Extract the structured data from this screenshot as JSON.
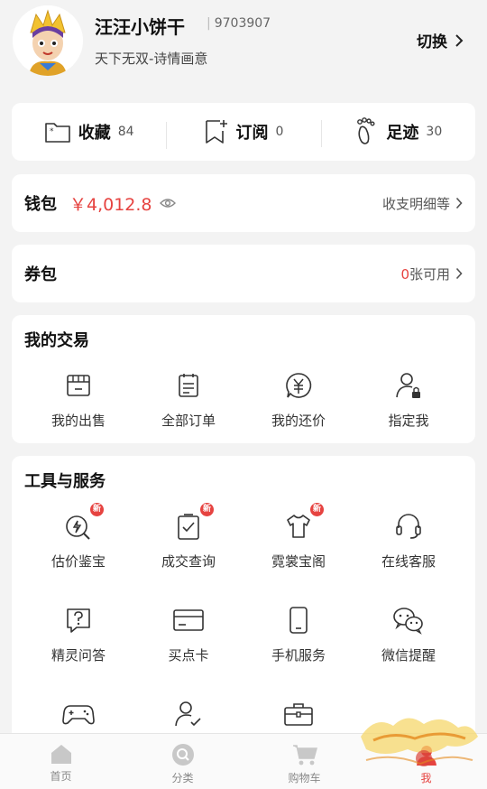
{
  "profile": {
    "username": "汪汪小饼干",
    "uid": "9703907",
    "server": "天下无双-诗情画意",
    "switch_label": "切换"
  },
  "stats": [
    {
      "label": "收藏",
      "count": "84",
      "icon": "folder-icon"
    },
    {
      "label": "订阅",
      "count": "0",
      "icon": "bookmark-add-icon"
    },
    {
      "label": "足迹",
      "count": "30",
      "icon": "footprint-icon"
    }
  ],
  "wallet": {
    "title": "钱包",
    "amount": "￥4,012.8",
    "detail_label": "收支明细等"
  },
  "coupon": {
    "title": "券包",
    "available_count": "0",
    "available_suffix": "张可用"
  },
  "trade": {
    "title": "我的交易",
    "items": [
      {
        "label": "我的出售",
        "icon": "store-icon"
      },
      {
        "label": "全部订单",
        "icon": "order-list-icon"
      },
      {
        "label": "我的还价",
        "icon": "yuan-chat-icon"
      },
      {
        "label": "指定我",
        "icon": "user-lock-icon"
      }
    ]
  },
  "tools": {
    "title": "工具与服务",
    "badge_text": "新",
    "items": [
      {
        "label": "估价鉴宝",
        "icon": "appraise-icon",
        "badge": true
      },
      {
        "label": "成交查询",
        "icon": "deal-query-icon",
        "badge": true
      },
      {
        "label": "霓裳宝阁",
        "icon": "clothing-icon",
        "badge": true
      },
      {
        "label": "在线客服",
        "icon": "headset-icon",
        "badge": false
      },
      {
        "label": "精灵问答",
        "icon": "question-chat-icon",
        "badge": false
      },
      {
        "label": "买点卡",
        "icon": "card-icon",
        "badge": false
      },
      {
        "label": "手机服务",
        "icon": "phone-icon",
        "badge": false
      },
      {
        "label": "微信提醒",
        "icon": "wechat-icon",
        "badge": false
      },
      {
        "label": "",
        "icon": "gamepad-icon",
        "badge": false
      },
      {
        "label": "",
        "icon": "user-check-icon",
        "badge": false
      },
      {
        "label": "",
        "icon": "briefcase-icon",
        "badge": false
      }
    ]
  },
  "tabbar": {
    "items": [
      {
        "label": "首页",
        "icon": "home-icon"
      },
      {
        "label": "分类",
        "icon": "search-category-icon"
      },
      {
        "label": "购物车",
        "icon": "cart-icon"
      },
      {
        "label": "我",
        "icon": "profile-icon"
      }
    ]
  },
  "colors": {
    "accent": "#e64340",
    "background": "#f3f3f3",
    "card": "#ffffff"
  }
}
